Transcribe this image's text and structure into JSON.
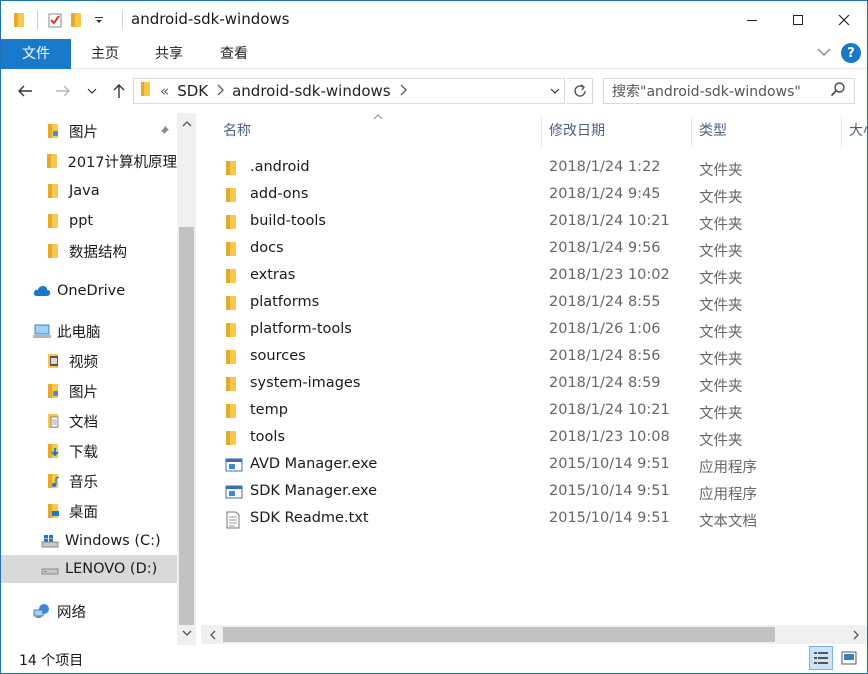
{
  "window": {
    "title": "android-sdk-windows",
    "controls": {
      "minimize": "—",
      "maximize": "☐",
      "close": "✕"
    }
  },
  "ribbon": {
    "tabs": [
      {
        "label": "文件",
        "active": true
      },
      {
        "label": "主页"
      },
      {
        "label": "共享"
      },
      {
        "label": "查看"
      }
    ],
    "help": "?"
  },
  "address": {
    "overflow": "«",
    "crumbs": [
      "SDK",
      "android-sdk-windows"
    ],
    "search_placeholder": "搜索\"android-sdk-windows\""
  },
  "sidebar": {
    "items": [
      {
        "label": "图片",
        "icon": "folder-pictures-icon",
        "pinned": true
      },
      {
        "label": "2017计算机原理",
        "icon": "folder-icon"
      },
      {
        "label": "Java",
        "icon": "folder-icon"
      },
      {
        "label": "ppt",
        "icon": "folder-icon"
      },
      {
        "label": "数据结构",
        "icon": "folder-icon"
      },
      {
        "label": "OneDrive",
        "icon": "cloud-icon"
      },
      {
        "label": "此电脑",
        "icon": "computer-icon"
      },
      {
        "label": "视频",
        "icon": "videos-icon"
      },
      {
        "label": "图片",
        "icon": "pictures-icon"
      },
      {
        "label": "文档",
        "icon": "documents-icon"
      },
      {
        "label": "下载",
        "icon": "downloads-icon"
      },
      {
        "label": "音乐",
        "icon": "music-icon"
      },
      {
        "label": "桌面",
        "icon": "desktop-icon"
      },
      {
        "label": "Windows (C:)",
        "icon": "windows-drive-icon"
      },
      {
        "label": "LENOVO (D:)",
        "icon": "drive-icon",
        "selected": true
      },
      {
        "label": "网络",
        "icon": "network-icon"
      }
    ]
  },
  "columns": {
    "name": "名称",
    "date": "修改日期",
    "type": "类型",
    "size": "大小"
  },
  "files": [
    {
      "name": ".android",
      "date": "2018/1/24 1:22",
      "type": "文件夹",
      "icon": "folder-icon"
    },
    {
      "name": "add-ons",
      "date": "2018/1/24 9:45",
      "type": "文件夹",
      "icon": "folder-icon"
    },
    {
      "name": "build-tools",
      "date": "2018/1/24 10:21",
      "type": "文件夹",
      "icon": "folder-icon"
    },
    {
      "name": "docs",
      "date": "2018/1/24 9:56",
      "type": "文件夹",
      "icon": "folder-icon"
    },
    {
      "name": "extras",
      "date": "2018/1/23 10:02",
      "type": "文件夹",
      "icon": "folder-icon"
    },
    {
      "name": "platforms",
      "date": "2018/1/24 8:55",
      "type": "文件夹",
      "icon": "folder-icon"
    },
    {
      "name": "platform-tools",
      "date": "2018/1/26 1:06",
      "type": "文件夹",
      "icon": "folder-icon"
    },
    {
      "name": "sources",
      "date": "2018/1/24 8:56",
      "type": "文件夹",
      "icon": "folder-icon"
    },
    {
      "name": "system-images",
      "date": "2018/1/24 8:59",
      "type": "文件夹",
      "icon": "folder-icon"
    },
    {
      "name": "temp",
      "date": "2018/1/24 10:21",
      "type": "文件夹",
      "icon": "folder-icon"
    },
    {
      "name": "tools",
      "date": "2018/1/23 10:08",
      "type": "文件夹",
      "icon": "folder-icon"
    },
    {
      "name": "AVD Manager.exe",
      "date": "2015/10/14 9:51",
      "type": "应用程序",
      "icon": "exe-icon"
    },
    {
      "name": "SDK Manager.exe",
      "date": "2015/10/14 9:51",
      "type": "应用程序",
      "icon": "exe-icon"
    },
    {
      "name": "SDK Readme.txt",
      "date": "2015/10/14 9:51",
      "type": "文本文档",
      "icon": "text-file-icon"
    }
  ],
  "status": {
    "count": "14 个项目"
  },
  "colors": {
    "accent": "#1979ca",
    "folder": "#f8c74d",
    "selected": "#d9d9d9"
  }
}
